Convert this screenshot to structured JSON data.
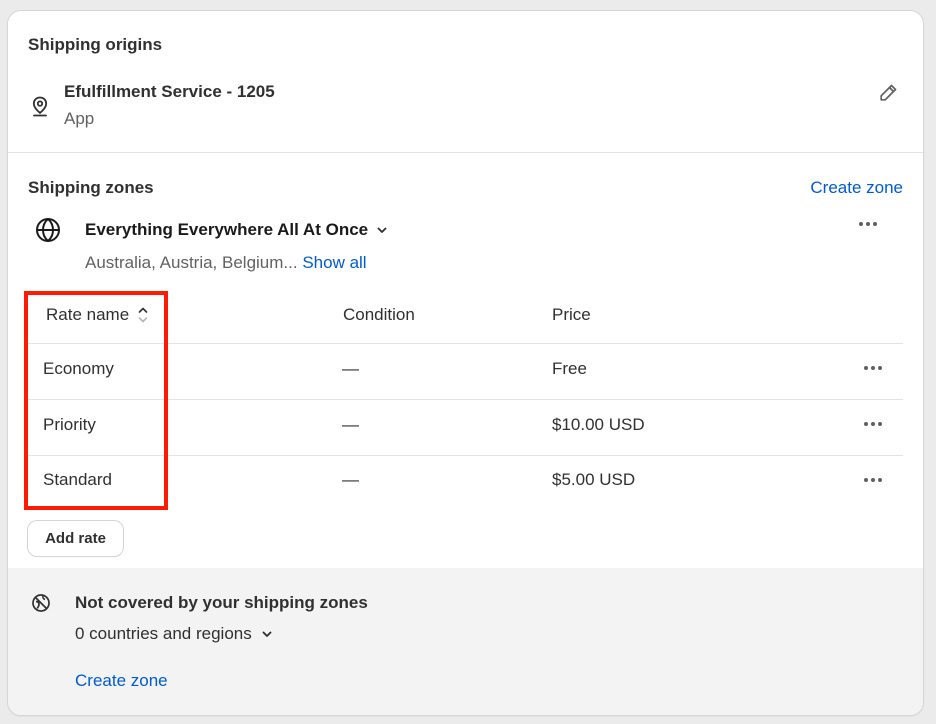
{
  "origins": {
    "title": "Shipping origins",
    "location_name": "Efulfillment Service - 1205",
    "location_type": "App",
    "icons": {
      "location": "location-pin-icon",
      "edit": "pencil-edit-icon"
    }
  },
  "zones": {
    "title": "Shipping zones",
    "create_zone_label": "Create zone",
    "zone": {
      "name": "Everything Everywhere All At Once",
      "countries": "Australia, Austria, Belgium...",
      "show_all_label": "Show all",
      "icons": {
        "globe": "globe-icon",
        "chevron": "chevron-down-icon",
        "menu": "more-horizontal-icon"
      }
    },
    "table": {
      "headers": {
        "rate_name": "Rate name",
        "condition": "Condition",
        "price": "Price"
      },
      "rows": [
        {
          "name": "Economy",
          "condition": "—",
          "price": "Free"
        },
        {
          "name": "Priority",
          "condition": "—",
          "price": "$10.00 USD"
        },
        {
          "name": "Standard",
          "condition": "—",
          "price": "$5.00 USD"
        }
      ]
    },
    "add_rate_label": "Add rate"
  },
  "not_covered": {
    "title": "Not covered by your shipping zones",
    "count_label": "0 countries and regions",
    "create_zone_label": "Create zone"
  },
  "colors": {
    "link": "#005bd3",
    "highlight": "#ff1a00",
    "footer_bg": "#f3f3f3"
  }
}
